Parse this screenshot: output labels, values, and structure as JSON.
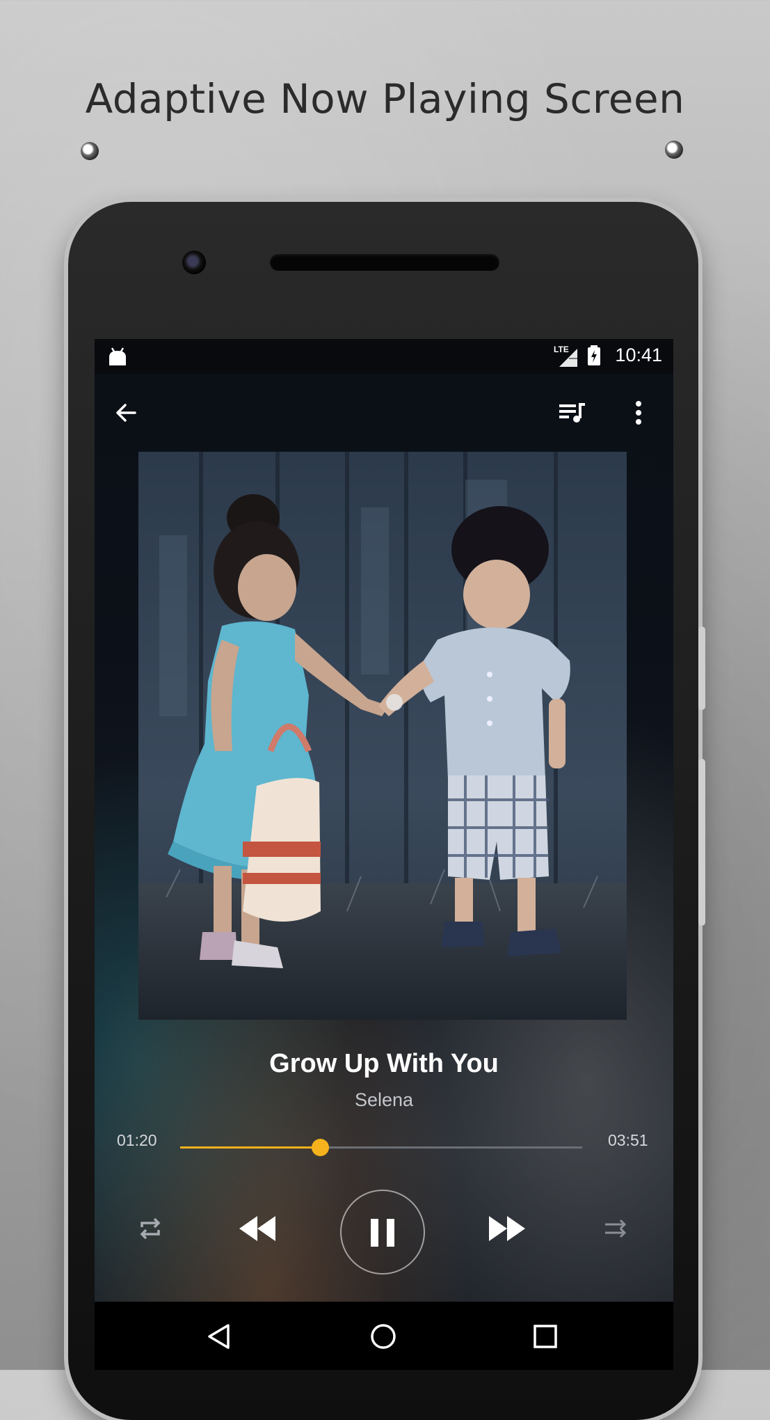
{
  "headline": "Adaptive Now Playing Screen",
  "status_bar": {
    "time": "10:41",
    "network": "LTE",
    "icons": [
      "android-icon",
      "signal-icon",
      "battery-charging-icon"
    ]
  },
  "toolbar": {
    "icons": [
      "back-arrow-icon",
      "queue-music-icon",
      "more-vert-icon"
    ]
  },
  "track": {
    "title": "Grow Up With You",
    "artist": "Selena",
    "elapsed": "01:20",
    "duration": "03:51",
    "progress": 0.347
  },
  "controls": {
    "icons": [
      "repeat-icon",
      "rewind-icon",
      "pause-icon",
      "fast-forward-icon",
      "shuffle-icon"
    ]
  },
  "nav_bar": {
    "icons": [
      "back-triangle-icon",
      "home-circle-icon",
      "recents-square-icon"
    ]
  },
  "colors": {
    "accent": "#f5b21c",
    "screen_bg": "#0c1119",
    "text_primary": "#ffffff",
    "text_secondary": "#c4c7cc"
  }
}
